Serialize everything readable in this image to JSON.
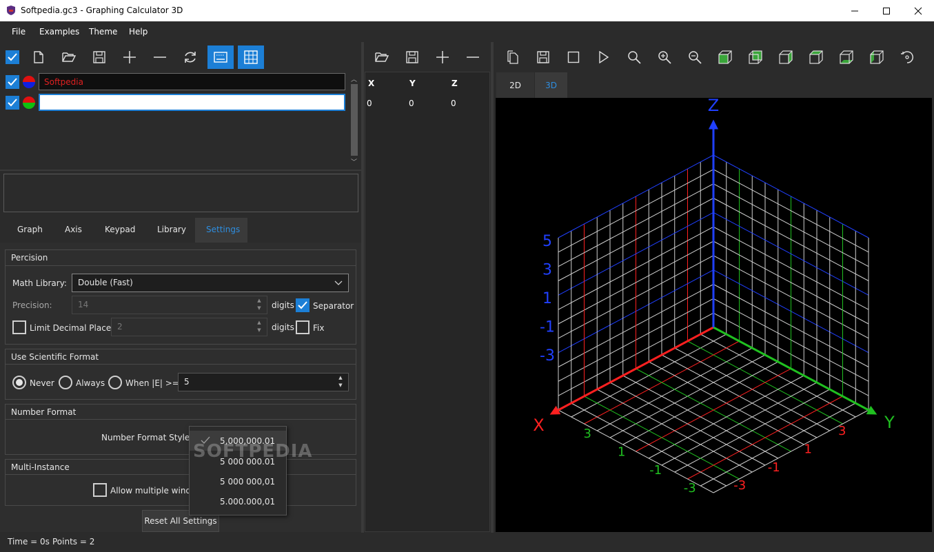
{
  "window": {
    "title": "Softpedia.gc3 - Graphing Calculator 3D"
  },
  "menu": {
    "items": [
      "File",
      "Examples",
      "Theme",
      "Help"
    ]
  },
  "equations": [
    {
      "value": "Softpedia",
      "checked": true
    },
    {
      "value": "",
      "checked": true
    }
  ],
  "tabs": [
    {
      "label": "Graph",
      "active": false
    },
    {
      "label": "Axis",
      "active": false
    },
    {
      "label": "Keypad",
      "active": false
    },
    {
      "label": "Library",
      "active": false
    },
    {
      "label": "Settings",
      "active": true
    }
  ],
  "settings": {
    "percision": {
      "title": "Percision",
      "math_library_label": "Math Library:",
      "math_library_value": "Double (Fast)",
      "precision_label": "Precision:",
      "precision_value": "14",
      "digits_label": "digits",
      "separator_label": "Separator",
      "separator_checked": true,
      "limit_label": "Limit Decimal Places:",
      "limit_value": "2",
      "limit_checked": false,
      "fix_label": "Fix",
      "fix_checked": false
    },
    "scientific": {
      "title": "Use Scientific Format",
      "options": [
        "Never",
        "Always",
        "When |E| >="
      ],
      "selected": "Never",
      "threshold": "5"
    },
    "number_format": {
      "title": "Number Format",
      "style_label": "Number Format Style:",
      "options": [
        "5,000,000.01",
        "5 000 000.01",
        "5 000 000,01",
        "5.000.000,01"
      ],
      "selected": "5,000,000.01"
    },
    "multi_instance": {
      "title": "Multi-Instance",
      "allow_label": "Allow multiple windows",
      "allow_checked": false
    },
    "reset_label": "Reset All Settings"
  },
  "status": {
    "time": "Time = 0s",
    "points": "Points = 2"
  },
  "points_table": {
    "headers": [
      "X",
      "Y",
      "Z"
    ],
    "rows": [
      [
        "0",
        "0",
        "0"
      ]
    ]
  },
  "graph": {
    "view_tabs": [
      {
        "label": "2D",
        "active": false
      },
      {
        "label": "3D",
        "active": true
      }
    ],
    "axis_labels": {
      "x": "X",
      "y": "Y",
      "z": "Z"
    },
    "z_ticks": [
      "5",
      "3",
      "1",
      "-1",
      "-3"
    ],
    "x_ticks": [
      "3",
      "1",
      "-1",
      "-3"
    ],
    "y_ticks": [
      "3",
      "1",
      "-1",
      "-3"
    ],
    "colors": {
      "x": "#ff2020",
      "y": "#20c020",
      "z": "#2040ff",
      "grid": "#d0d0d0"
    }
  },
  "watermark": "SOFTPEDIA",
  "colors": {
    "accent": "#1c7fd6",
    "background": "#2b2b2b",
    "panel": "#1e1e1e",
    "plot": "#000000"
  }
}
